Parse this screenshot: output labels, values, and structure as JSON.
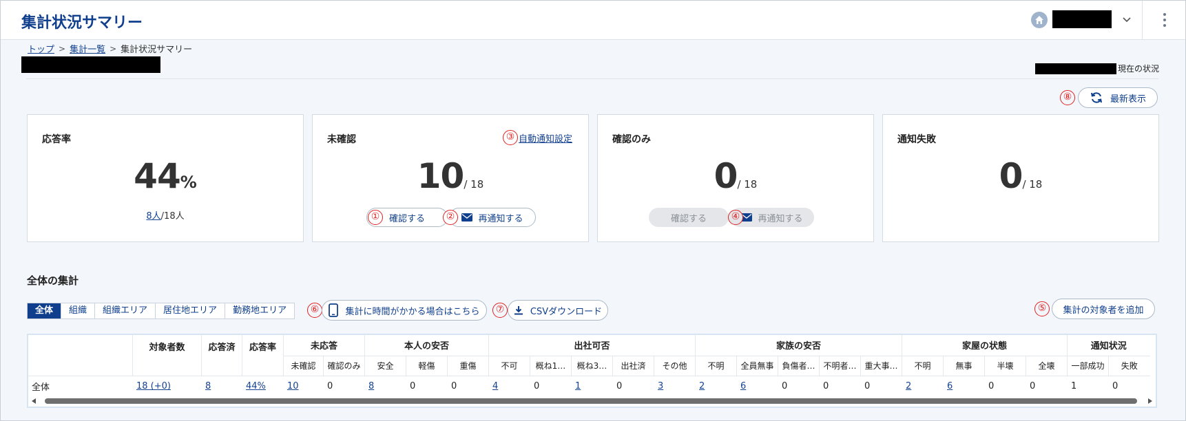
{
  "header": {
    "title": "集計状況サマリー"
  },
  "breadcrumb": {
    "top": "トップ",
    "list": "集計一覧",
    "current": "集計状況サマリー",
    "sep": ">"
  },
  "status": {
    "suffix": "現在の状況"
  },
  "refresh": {
    "num": "⑧",
    "label": "最新表示"
  },
  "cards": {
    "response": {
      "title": "応答率",
      "value": "44",
      "unit": "%",
      "link": "8人",
      "rest": "/18人"
    },
    "unconfirmed": {
      "title": "未確認",
      "value": "10",
      "denom": "/ 18",
      "auto_num": "③",
      "auto_link": "自動通知設定",
      "confirm_num": "①",
      "confirm": "確認する",
      "renotify_num": "②",
      "renotify": "再通知する"
    },
    "confirm_only": {
      "title": "確認のみ",
      "value": "0",
      "denom": "/ 18",
      "confirm": "確認する",
      "renotify_num": "④",
      "renotify": "再通知する"
    },
    "failed": {
      "title": "通知失敗",
      "value": "0",
      "denom": "/ 18"
    }
  },
  "section": {
    "title": "全体の集計",
    "tabs": [
      "全体",
      "組織",
      "組織エリア",
      "居住地エリア",
      "勤務地エリア"
    ],
    "slow_num": "⑥",
    "slow": "集計に時間がかかる場合はこちら",
    "csv_num": "⑦",
    "csv": "CSVダウンロード",
    "add_num": "⑤",
    "add": "集計の対象者を追加"
  },
  "table": {
    "groups": [
      "対象者数",
      "応答済",
      "応答率",
      "未応答",
      "本人の安否",
      "出社可否",
      "家族の安否",
      "家屋の状態",
      "通知状況"
    ],
    "sub": [
      "未確認",
      "確認のみ",
      "安全",
      "軽傷",
      "重傷",
      "不可",
      "概ね1…",
      "概ね3…",
      "出社済",
      "その他",
      "不明",
      "全員無事",
      "負傷者…",
      "不明者…",
      "重大事…",
      "不明",
      "無事",
      "半壊",
      "全壊",
      "一部成功",
      "失敗"
    ],
    "row": {
      "label": "全体",
      "cells": [
        "18 (+0)",
        "8",
        "44%",
        "10",
        "0",
        "8",
        "0",
        "0",
        "4",
        "0",
        "1",
        "0",
        "3",
        "2",
        "6",
        "0",
        "0",
        "0",
        "2",
        "6",
        "0",
        "0",
        "1",
        "0"
      ]
    }
  }
}
